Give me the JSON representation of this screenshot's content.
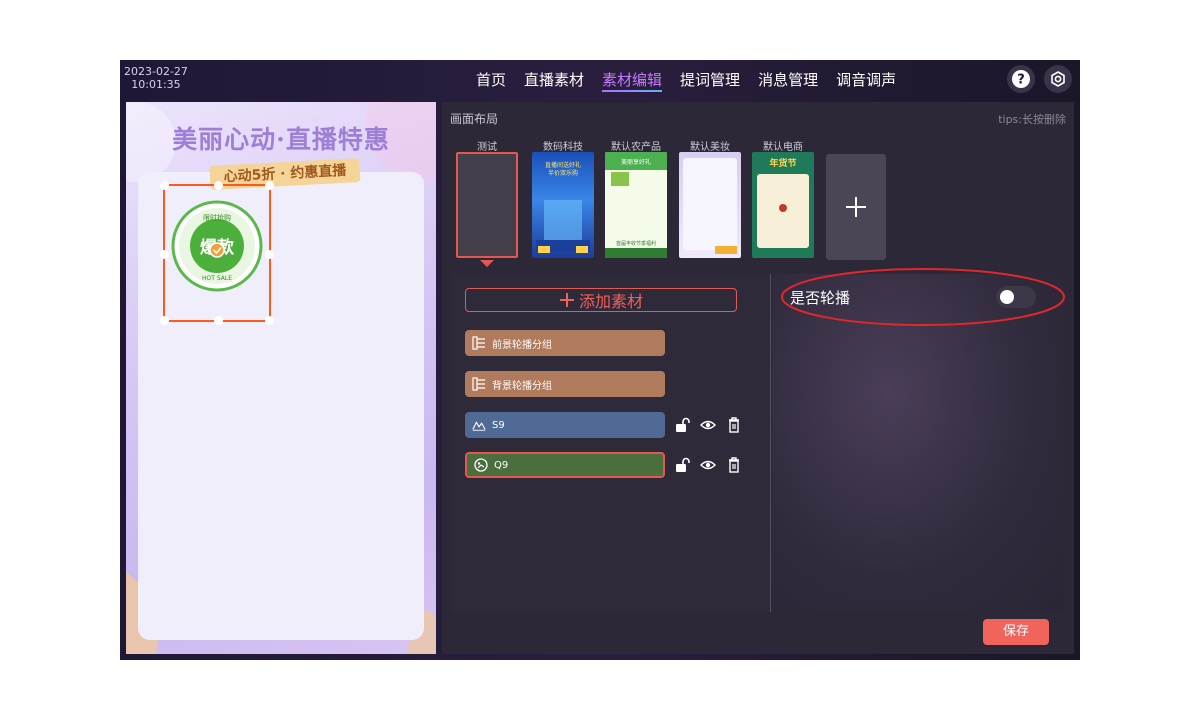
{
  "clock": {
    "date": "2023-02-27",
    "time": "10:01:35"
  },
  "nav": {
    "items": [
      "首页",
      "直播素材",
      "素材编辑",
      "提词管理",
      "消息管理",
      "调音调声"
    ],
    "active_index": 2
  },
  "header_icons": [
    "help-icon",
    "settings-icon"
  ],
  "preview": {
    "banner_title": "美丽心动·直播特惠",
    "banner_subtitle": "心动5折 · 约惠直播",
    "badge_top": "限时抢购",
    "badge_main": "爆款",
    "badge_bottom": "HOT SALE"
  },
  "editor": {
    "title": "画面布局",
    "tips": "tips:长按删除",
    "layouts": [
      {
        "label": "测试",
        "selected": true
      },
      {
        "label": "数码科技",
        "caption": "直播间送好礼\n半价双乐购"
      },
      {
        "label": "默认农产品",
        "caption": "美丽享好礼",
        "footer": "首届丰收节季福利"
      },
      {
        "label": "默认美妆"
      },
      {
        "label": "默认电商",
        "caption": "年货节"
      }
    ],
    "add_material_label": "添加素材",
    "materials": [
      {
        "label": "前景轮播分组",
        "type": "group",
        "color": "#b07a5c"
      },
      {
        "label": "背景轮播分组",
        "type": "group",
        "color": "#b07a5c"
      },
      {
        "label": "S9",
        "type": "image",
        "color": "#4f6a94",
        "tools": [
          "unlock-icon",
          "eye-icon",
          "trash-icon"
        ]
      },
      {
        "label": "Q9",
        "type": "sticker",
        "color": "#4a6e3e",
        "selected": true,
        "tools": [
          "unlock-icon",
          "eye-icon",
          "trash-icon"
        ]
      }
    ],
    "carousel_label": "是否轮播",
    "carousel_enabled": false,
    "save_label": "保存"
  },
  "colors": {
    "accent": "#f0645b",
    "nav_active": "#c47bff",
    "selection": "#ff5a1e"
  }
}
